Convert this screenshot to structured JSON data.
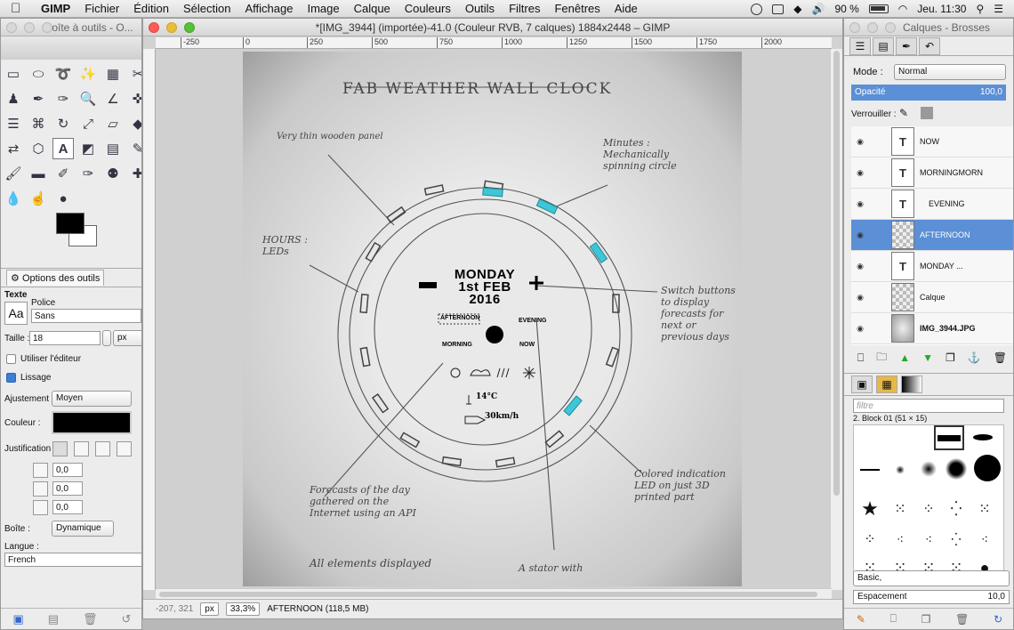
{
  "menubar": {
    "apple": "",
    "items": [
      "GIMP",
      "Fichier",
      "Édition",
      "Sélection",
      "Affichage",
      "Image",
      "Calque",
      "Couleurs",
      "Outils",
      "Filtres",
      "Fenêtres",
      "Aide"
    ],
    "battery": "90 %",
    "clock": "Jeu. 11:30"
  },
  "toolbox": {
    "title": "Boîte à outils - O...",
    "options_tab": "Options des outils",
    "text_header": "Texte",
    "font_icon": "Aa",
    "police_label": "Police",
    "police_value": "Sans",
    "taille_label": "Taille :",
    "taille_value": "18",
    "taille_unit": "px",
    "use_editor": "Utiliser l'éditeur",
    "lissage": "Lissage",
    "ajustement_label": "Ajustement :",
    "ajustement_value": "Moyen",
    "couleur_label": "Couleur :",
    "justification_label": "Justification :",
    "indent_value": "0,0",
    "line_spacing_value": "0,0",
    "letter_spacing_value": "0,0",
    "boite_label": "Boîte :",
    "boite_value": "Dynamique",
    "langue_label": "Langue :",
    "langue_value": "French",
    "fg_color": "#000000",
    "bg_color": "#ffffff"
  },
  "image_window": {
    "title": "*[IMG_3944] (importée)-41.0 (Couleur RVB, 7 calques) 1884x2448 – GIMP",
    "ruler_ticks": [
      "-250",
      "0",
      "250",
      "500",
      "750",
      "1000",
      "1250",
      "1500",
      "1750",
      "2000"
    ],
    "status_coords": "-207, 321",
    "status_unit": "px",
    "status_zoom": "33,3%",
    "status_info": "AFTERNOON (118,5 MB)"
  },
  "canvas_overlay": {
    "line1": "MONDAY",
    "line2": "1st FEB",
    "line3": "2016",
    "afternoon": "AFTERNOON",
    "evening": "EVENING",
    "morning": "MORNING",
    "now": "NOW",
    "temp": "14°C",
    "wind": "30km/h"
  },
  "sketch_text": {
    "title": "FAB WEATHER WALL CLOCK",
    "n1": "Very thin wooden panel",
    "n2": "Minutes : Mechanically spinning circle",
    "n3": "HOURS : LEDs",
    "n4": "Switch buttons to display forecasts for next or previous days",
    "n5": "Colored indication LED on just 3D printed part",
    "n6": "Forecasts of the day gathered on the Internet using an API",
    "n7": "All elements displayed",
    "n8": "A stator with"
  },
  "layers_window": {
    "title": "Calques - Brosses",
    "mode_label": "Mode :",
    "mode_value": "Normal",
    "opacity_label": "Opacité",
    "opacity_value": "100,0",
    "lock_label": "Verrouiller :",
    "layers": [
      {
        "name": "NOW",
        "type": "text"
      },
      {
        "name": "MORNINGMORN",
        "type": "text"
      },
      {
        "name": "EVENING",
        "type": "text"
      },
      {
        "name": "AFTERNOON",
        "type": "transparent",
        "selected": true
      },
      {
        "name": "MONDAY ...",
        "type": "text"
      },
      {
        "name": "Calque",
        "type": "transparent"
      },
      {
        "name": "IMG_3944.JPG",
        "type": "photo"
      }
    ],
    "filter_placeholder": "filtre",
    "brush_name": "2. Block 01 (51 × 15)",
    "brush_set": "Basic,",
    "spacing_label": "Espacement",
    "spacing_value": "10,0",
    "accent": "#5b8fd6"
  }
}
